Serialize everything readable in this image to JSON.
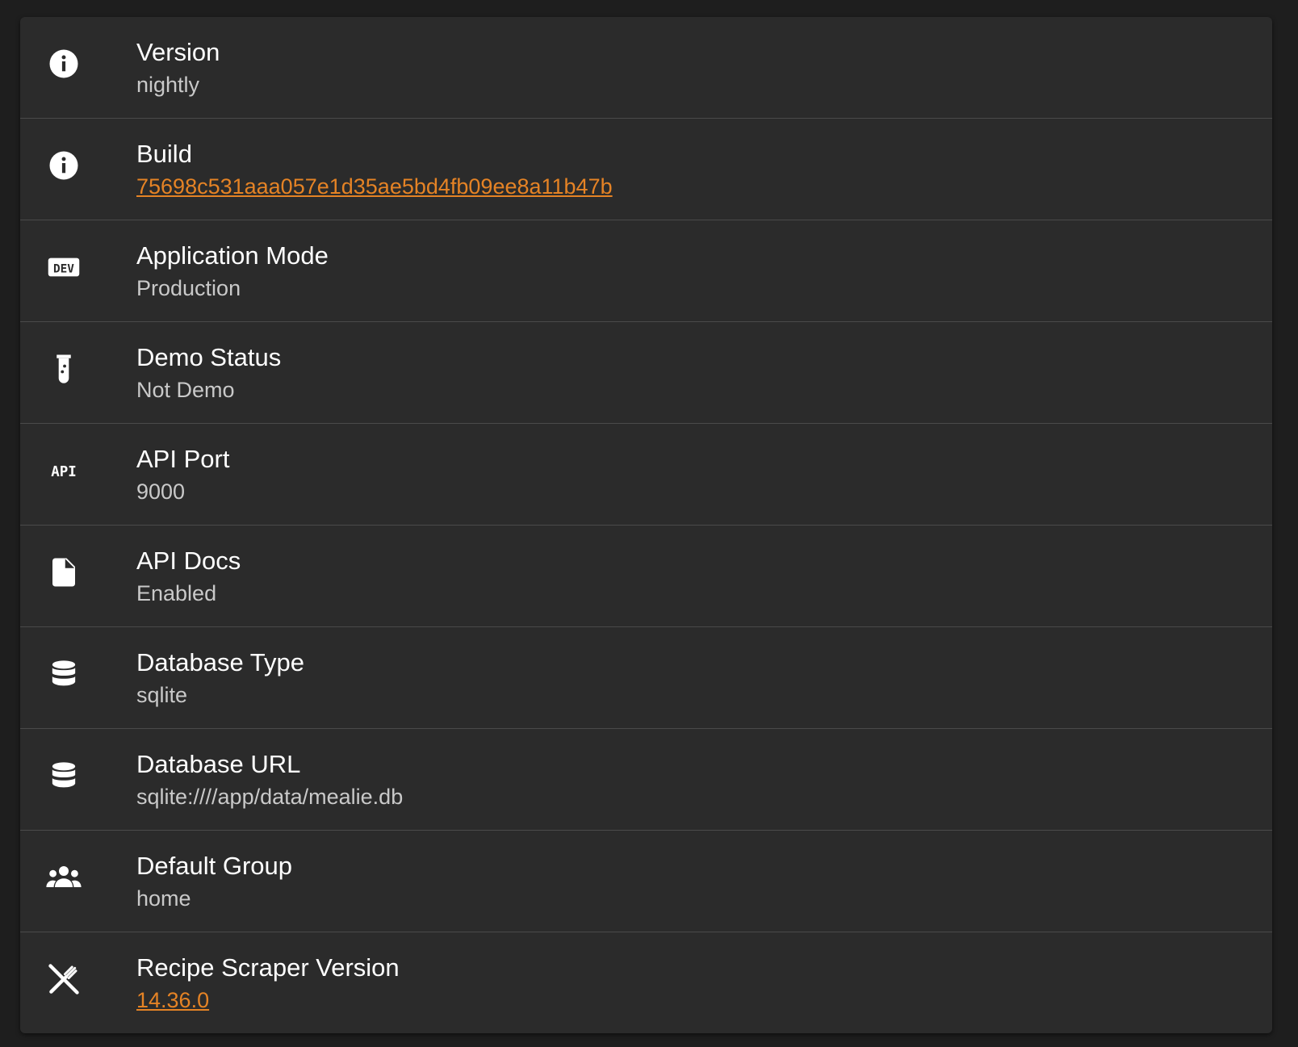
{
  "colors": {
    "background": "#1e1e1e",
    "card": "#2b2b2b",
    "divider": "#4a4a4a",
    "title": "#ffffff",
    "value": "#c9c9c9",
    "link": "#e58325"
  },
  "items": [
    {
      "icon": "info-icon",
      "title": "Version",
      "value": "nightly",
      "link": false
    },
    {
      "icon": "info-icon",
      "title": "Build",
      "value": "75698c531aaa057e1d35ae5bd4fb09ee8a11b47b",
      "link": true
    },
    {
      "icon": "dev-icon",
      "title": "Application Mode",
      "value": "Production",
      "link": false
    },
    {
      "icon": "test-tube-icon",
      "title": "Demo Status",
      "value": "Not Demo",
      "link": false
    },
    {
      "icon": "api-icon",
      "title": "API Port",
      "value": "9000",
      "link": false
    },
    {
      "icon": "file-icon",
      "title": "API Docs",
      "value": "Enabled",
      "link": false
    },
    {
      "icon": "database-icon",
      "title": "Database Type",
      "value": "sqlite",
      "link": false
    },
    {
      "icon": "database-icon",
      "title": "Database URL",
      "value": "sqlite:////app/data/mealie.db",
      "link": false
    },
    {
      "icon": "account-group-icon",
      "title": "Default Group",
      "value": "home",
      "link": false
    },
    {
      "icon": "silverware-icon",
      "title": "Recipe Scraper Version",
      "value": "14.36.0",
      "link": true
    }
  ]
}
